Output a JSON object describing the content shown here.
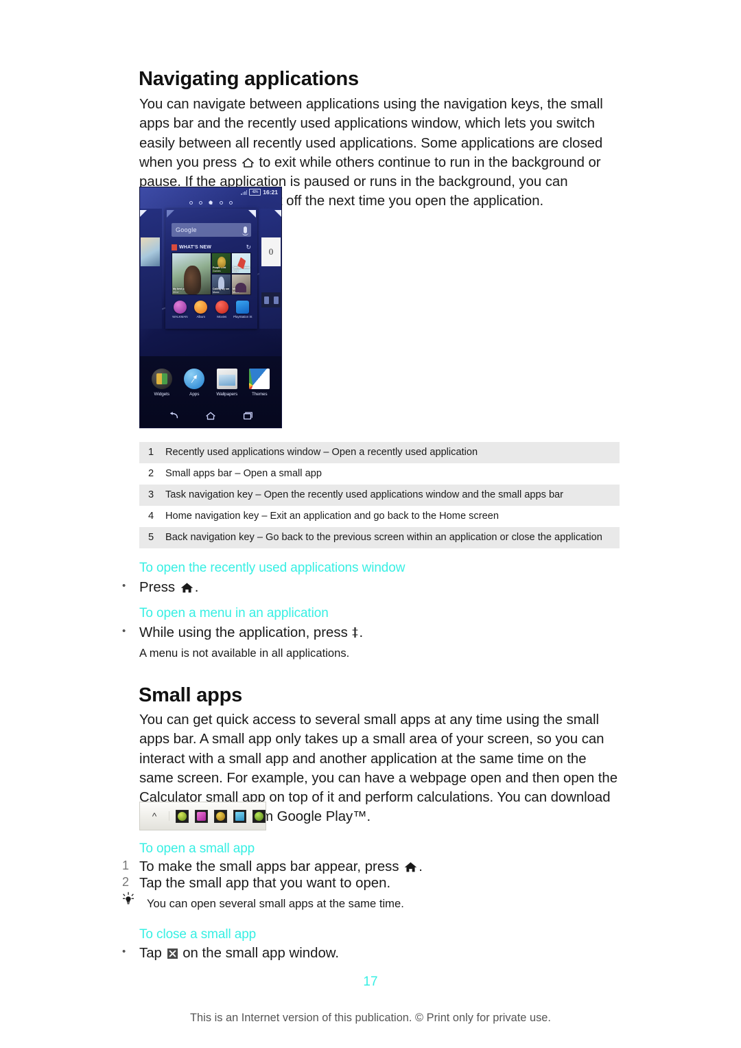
{
  "document": {
    "page_number": "17",
    "footer_note": "This is an Internet version of this publication. © Print only for private use."
  },
  "sections": {
    "navigating": {
      "heading": "Navigating applications",
      "paragraph_part1": "You can navigate between applications using the navigation keys, the small apps bar and the recently used applications window, which lets you switch easily between all recently used applications. Some applications are closed when you press ",
      "paragraph_part2": " to exit while others continue to run in the background or pause. If the application is paused or runs in the background, you can continue where you left off the next time you open the application."
    },
    "small_apps": {
      "heading": "Small apps",
      "paragraph": "You can get quick access to several small apps at any time using the small apps bar. A small app only takes up a small area of your screen, so you can interact with a small app and another application at the same time on the same screen. For example, you can have a webpage open and then open the Calculator small app on top of it and perform calculations. You can download more small apps from Google Play™."
    }
  },
  "legend": {
    "rows": [
      {
        "num": "1",
        "text": "Recently used applications window – Open a recently used application",
        "shaded": true
      },
      {
        "num": "2",
        "text": "Small apps bar – Open a small app",
        "shaded": false
      },
      {
        "num": "3",
        "text": "Task navigation key – Open the recently used applications window and the small apps bar",
        "shaded": true
      },
      {
        "num": "4",
        "text": "Home navigation key – Exit an application and go back to the Home screen",
        "shaded": false
      },
      {
        "num": "5",
        "text": "Back navigation key – Go back to the previous screen within an application or close the application",
        "shaded": true
      }
    ]
  },
  "tasks": {
    "open_recent": {
      "heading": "To open the recently used applications window",
      "bullet": "•",
      "step_prefix": "Press ",
      "step_suffix": "."
    },
    "open_menu": {
      "heading": "To open a menu in an application",
      "bullet": "•",
      "step_prefix": "While using the application, press ",
      "step_suffix": ".",
      "note": "A menu is not available in all applications."
    },
    "open_small_app": {
      "heading": "To open a small app",
      "step1_num": "1",
      "step1_prefix": "To make the small apps bar appear, press ",
      "step1_suffix": ".",
      "step2_num": "2",
      "step2_text": "Tap the small app that you want to open.",
      "tip": "You can open several small apps at the same time."
    },
    "close_small_app": {
      "heading": "To close a small app",
      "bullet": "•",
      "step_prefix": "Tap ",
      "step_suffix": " on the small app window."
    }
  },
  "phone_screenshot": {
    "status_time": "16:21",
    "battery_label": "41%",
    "search_placeholder": "Google",
    "whats_new_label": "WHAT'S NEW",
    "refresh_glyph": "↻",
    "tiles": [
      {
        "title": "My best pal",
        "sub": "2014"
      },
      {
        "title": "Purple Bird",
        "sub": "Games"
      },
      {
        "title": "Tranquil Game",
        "sub": "Apps"
      },
      {
        "title": "Calling My sm",
        "sub": "Music"
      },
      {
        "title": "Moonlight",
        "sub": "Movie"
      }
    ],
    "app_shortcuts": [
      {
        "label": "WALKMAN"
      },
      {
        "label": "Album"
      },
      {
        "label": "Movies"
      },
      {
        "label": "PlayStation St"
      }
    ],
    "dock_items": [
      {
        "label": "Widgets"
      },
      {
        "label": "Apps"
      },
      {
        "label": "Wallpapers"
      },
      {
        "label": "Themes"
      }
    ],
    "side_card_badge": "0"
  },
  "small_apps_bar": {
    "expand_glyph": "^",
    "icon_count": 5
  },
  "colors": {
    "accent_cyan": "#37efe3",
    "legend_shade": "#e9e9e9",
    "text": "#1a1a1a"
  }
}
